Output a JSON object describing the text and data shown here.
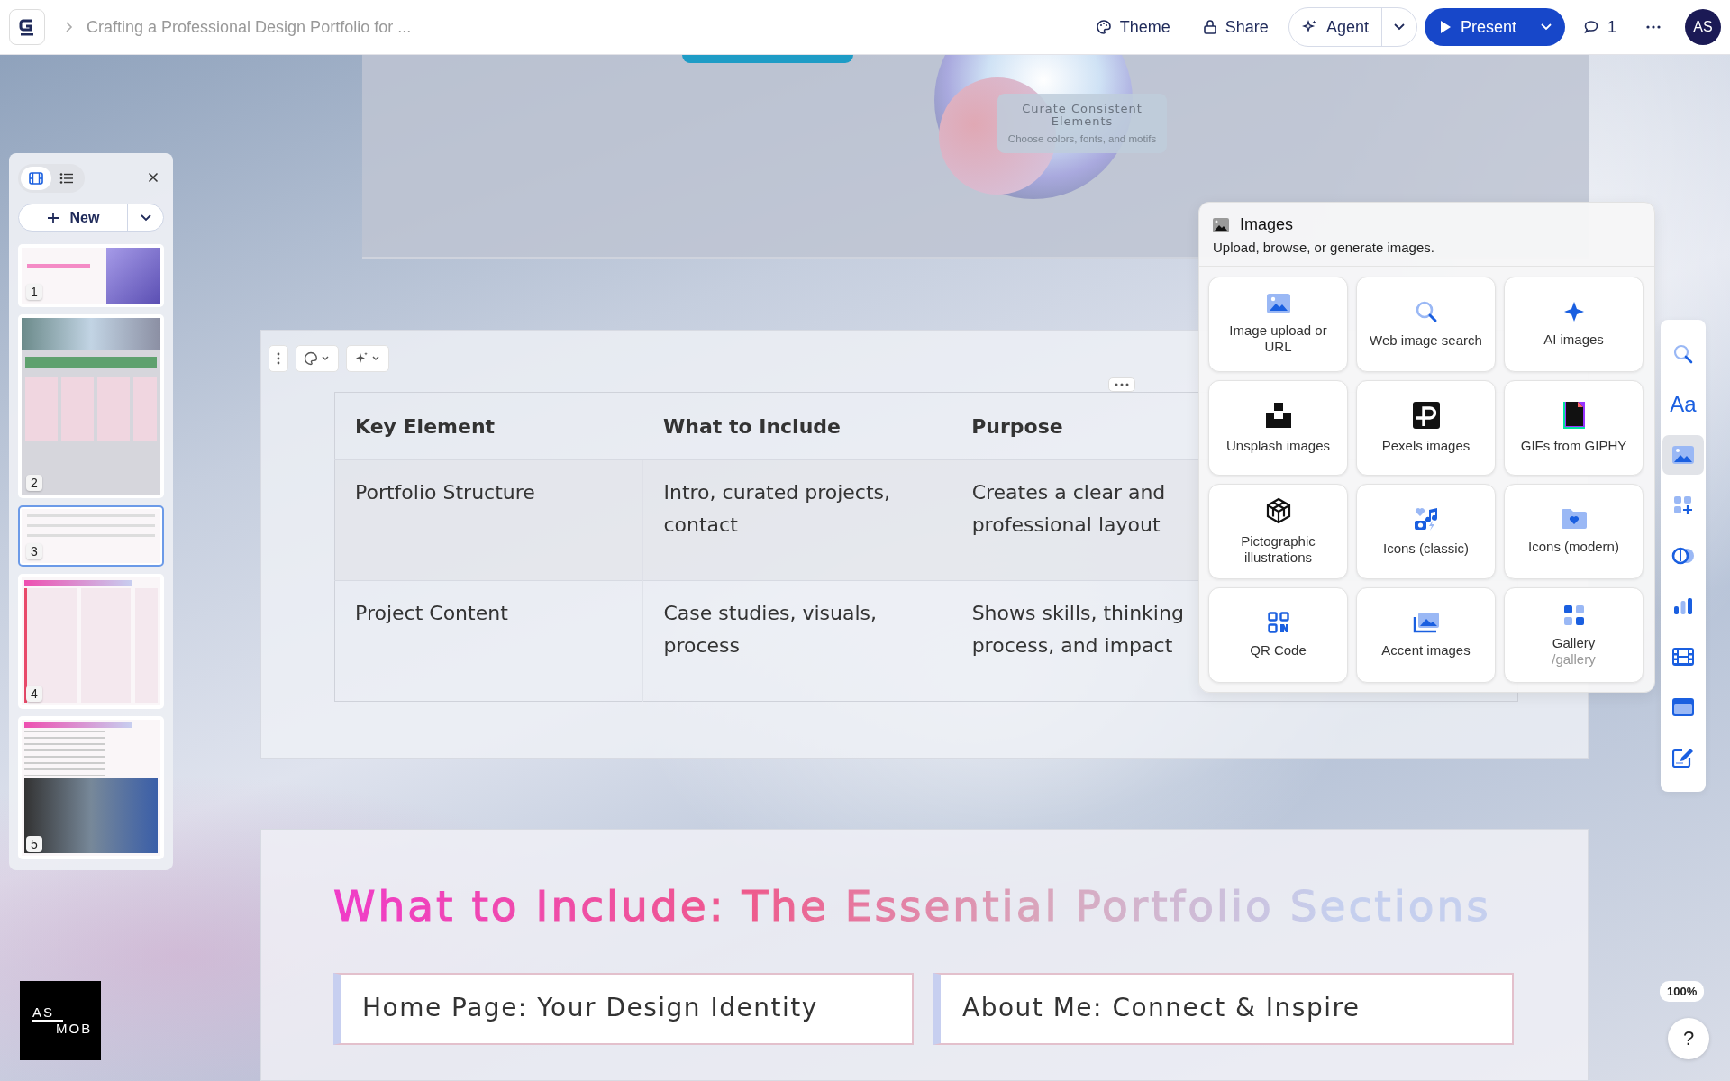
{
  "top_bar": {
    "breadcrumb": "Crafting a Professional Design Portfolio for ...",
    "buttons": [
      {
        "kind": "theme",
        "label": "Theme"
      },
      {
        "kind": "share",
        "label": "Share"
      }
    ],
    "agent": "Agent",
    "present": "Present",
    "comments": "1",
    "avatar": "AS"
  },
  "slides_panel": {
    "views": [
      {
        "kind": "filmstrip",
        "selected": true
      },
      {
        "kind": "list",
        "selected": false
      }
    ],
    "new_button": "New",
    "thumbnails": [
      {
        "kind": "title",
        "number": "1",
        "selected": false
      },
      {
        "kind": "article",
        "number": "2",
        "selected": false
      },
      {
        "kind": "table",
        "number": "3",
        "selected": true
      },
      {
        "kind": "cards",
        "number": "4",
        "selected": false
      },
      {
        "kind": "list",
        "number": "5",
        "selected": false
      }
    ]
  },
  "slide_top": {
    "card_title": "Curate Consistent Elements",
    "card_text": "Choose colors, fonts, and motifs"
  },
  "table": {
    "columns": [
      "Key Element",
      "What to Include",
      "Purpose"
    ],
    "rows": [
      [
        "Portfolio Structure",
        "Intro, curated projects, contact",
        "Creates a clear and professional layout"
      ],
      [
        "Project Content",
        "Case studies, visuals, process",
        "Shows skills, thinking process, and impact"
      ]
    ]
  },
  "slide_bottom": {
    "title": "What to Include: The Essential Portfolio Sections",
    "cards": [
      "Home Page: Your Design Identity",
      "About Me: Connect & Inspire"
    ]
  },
  "images_panel": {
    "title": "Images",
    "subtitle": "Upload, browse, or generate images.",
    "items": [
      {
        "kind": "upload",
        "label": "Image upload or URL"
      },
      {
        "kind": "web",
        "label": "Web image search"
      },
      {
        "kind": "ai",
        "label": "AI images"
      },
      {
        "kind": "unsplash",
        "label": "Unsplash images"
      },
      {
        "kind": "pexels",
        "label": "Pexels images"
      },
      {
        "kind": "giphy",
        "label": "GIFs from GIPHY"
      },
      {
        "kind": "picto",
        "label": "Pictographic illustrations"
      },
      {
        "kind": "classic",
        "label": "Icons (classic)"
      },
      {
        "kind": "modern",
        "label": "Icons (modern)"
      },
      {
        "kind": "qr",
        "label": "QR Code"
      },
      {
        "kind": "accent",
        "label": "Accent images"
      },
      {
        "kind": "gallery",
        "label": "Gallery",
        "hint": "/gallery"
      }
    ]
  },
  "tools": [
    {
      "kind": "search",
      "selected": false
    },
    {
      "kind": "text",
      "glyph": "Aa",
      "selected": false
    },
    {
      "kind": "image",
      "selected": true
    },
    {
      "kind": "blocks",
      "selected": false
    },
    {
      "kind": "toggle",
      "selected": false
    },
    {
      "kind": "chart",
      "selected": false
    },
    {
      "kind": "film",
      "selected": false
    },
    {
      "kind": "card",
      "selected": false
    },
    {
      "kind": "edit",
      "selected": false
    }
  ],
  "zoom": "100%",
  "help": "?",
  "logo": {
    "top": "AS",
    "bottom": "MOB"
  }
}
